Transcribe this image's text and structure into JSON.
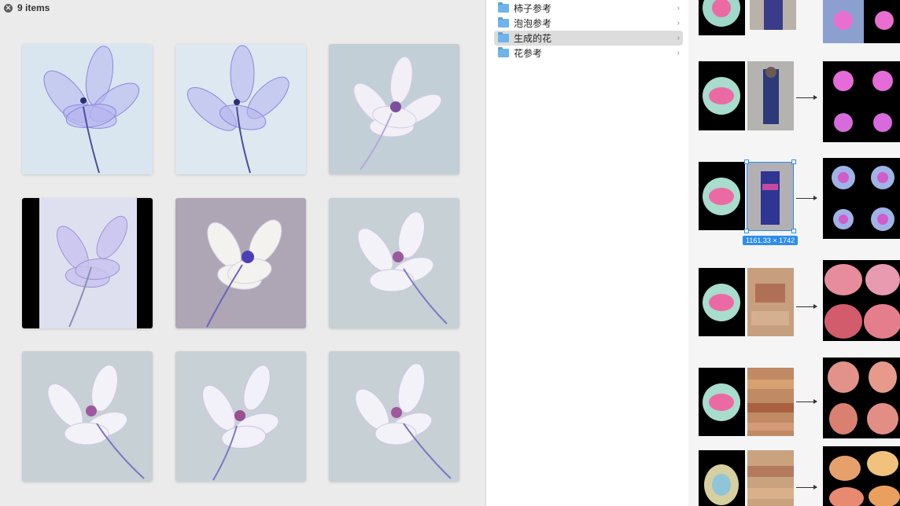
{
  "quicklook": {
    "item_count": "9 items",
    "thumbnails": [
      {
        "name": "flower-1"
      },
      {
        "name": "flower-2"
      },
      {
        "name": "flower-3"
      },
      {
        "name": "flower-4"
      },
      {
        "name": "flower-5"
      },
      {
        "name": "flower-6"
      },
      {
        "name": "flower-7"
      },
      {
        "name": "flower-8"
      },
      {
        "name": "flower-9"
      }
    ]
  },
  "finder": {
    "folders": [
      {
        "label": "柿子参考",
        "selected": false
      },
      {
        "label": "泡泡参考",
        "selected": false
      },
      {
        "label": "生成的花",
        "selected": true
      },
      {
        "label": "花参考",
        "selected": false
      }
    ]
  },
  "canvas": {
    "selection_size": "1161.33 × 1742"
  },
  "colors": {
    "accent": "#2d8cf0",
    "folder": "#6fb3e8",
    "panel_bg": "#ecebeb"
  }
}
